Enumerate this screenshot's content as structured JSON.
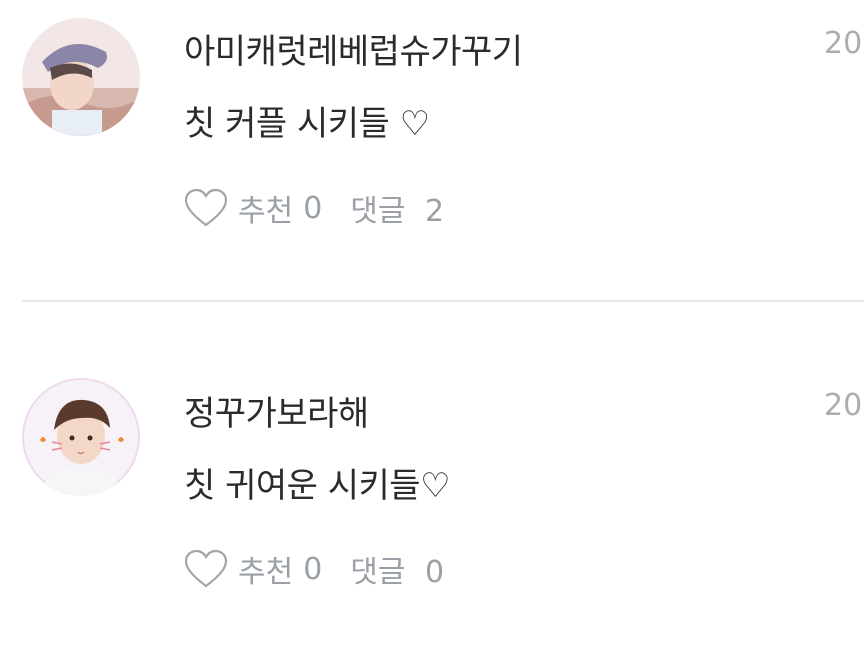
{
  "comments": [
    {
      "username": "아미캐럿레베럽슈가꾸기",
      "time": "20",
      "text": "칫 커플 시키들 ♡",
      "like_label": "추천",
      "like_count": "0",
      "reply_label": "댓글",
      "reply_count": "2",
      "avatar_icon": "avatar-user-photo"
    },
    {
      "username": "정꾸가보라해",
      "time": "20",
      "text": "칫 귀여운 시키들♡",
      "like_label": "추천",
      "like_count": "0",
      "reply_label": "댓글",
      "reply_count": "0",
      "avatar_icon": "avatar-user-photo"
    }
  ],
  "icons": {
    "like": "heart-outline-icon"
  },
  "colors": {
    "text": "#2b2b2b",
    "meta": "#9aa0a6",
    "time": "#a9aeb3",
    "divider": "#e7e9eb"
  }
}
